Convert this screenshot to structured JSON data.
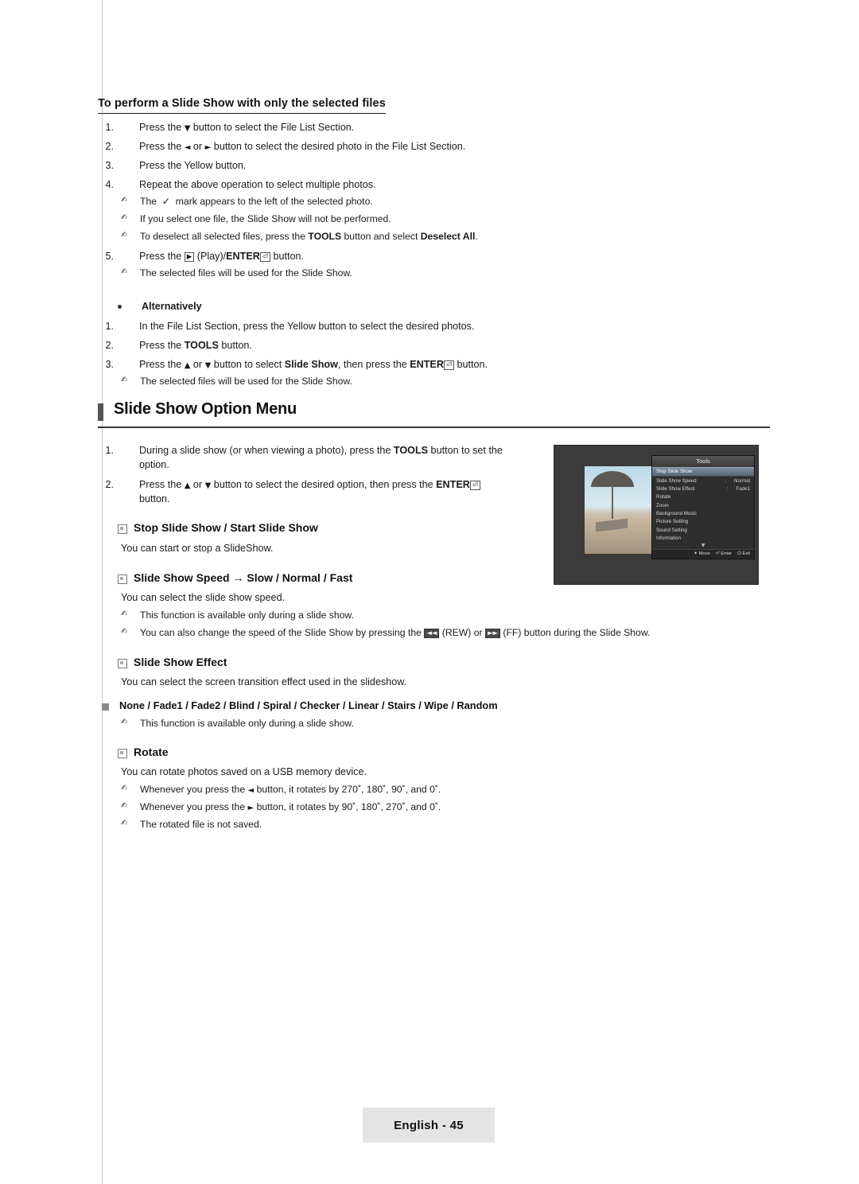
{
  "doc": {
    "section_title": "To perform a Slide Show with only the selected files",
    "steps": [
      {
        "idx": "1.",
        "text_pre": "Press the ",
        "glyph": "▼",
        "text_post": " button to select the File List Section."
      },
      {
        "idx": "2.",
        "text_pre": "Press the ",
        "glyph": "◄ or ►",
        "text_post": " button to select the desired photo in the File List Section."
      },
      {
        "idx": "3.",
        "text_pre": "Press the Yellow button.",
        "glyph": "",
        "text_post": ""
      },
      {
        "idx": "4.",
        "text_pre": "Repeat the above operation to select multiple photos.",
        "glyph": "",
        "text_post": ""
      }
    ],
    "notes_after_4": [
      "The  ✓  mark appears to the left of the selected photo.",
      "If you select one file, the Slide Show will not be performed.",
      "To deselect all selected files, press the TOOLS button and select Deselect All."
    ],
    "step5": {
      "idx": "5.",
      "text": "Press the ▶ (Play)/ENTER⏎ button."
    },
    "note_after_5": "The selected files will be used for the Slide Show.",
    "alternatively_label": "Alternatively",
    "alt_steps": [
      {
        "idx": "1.",
        "text": "In the File List Section, press the Yellow button to select the desired photos."
      },
      {
        "idx": "2.",
        "text": "Press the TOOLS button."
      },
      {
        "idx": "3.",
        "text": "Press the ▲ or ▼ button to select Slide Show, then press the ENTER⏎ button."
      }
    ],
    "alt_note": "The selected files will be used for the Slide Show.",
    "big_heading": "Slide Show Option Menu",
    "menu_steps": [
      {
        "idx": "1.",
        "line1": "During a slide show (or when viewing a photo), press the TOOLS button to set the",
        "line2": "option."
      },
      {
        "idx": "2.",
        "line1": "Press the ▲ or ▼ button to select the desired option, then press the ENTER⏎",
        "line2": "button."
      }
    ],
    "options": [
      {
        "title": "Stop Slide Show / Start Slide Show",
        "body": "You can start or stop a SlideShow.",
        "notes": []
      },
      {
        "title": "Slide Show Speed → Slow / Normal / Fast",
        "body": "You can select the slide show speed.",
        "notes": [
          "This function is available only during a slide show.",
          "You can also change the speed of the Slide Show by pressing the ◄◄ (REW) or ►► (FF) button during the Slide Show."
        ]
      },
      {
        "title": "Slide Show Effect",
        "body": "You can select the screen transition effect used in the slideshow.",
        "notes": []
      }
    ],
    "effect_list": "None / Fade1 / Fade2 / Blind / Spiral / Checker / Linear / Stairs / Wipe / Random",
    "effect_note": "This function is available only during a slide show.",
    "rotate": {
      "title": "Rotate",
      "body": "You can rotate photos saved on a USB memory device.",
      "notes": [
        "Whenever you press the ◄ button, it rotates by 270˚, 180˚, 90˚, and 0˚.",
        "Whenever you press the ► button, it rotates by 90˚, 180˚, 270˚, and 0˚.",
        "The rotated file is not saved."
      ]
    },
    "footer": "English - 45"
  },
  "tv": {
    "menu_title": "Tools",
    "items": [
      {
        "label": "Stop Slide Show",
        "value": "",
        "selected": true
      },
      {
        "label": "Slide Show Speed",
        "value": "Normal",
        "selected": false
      },
      {
        "label": "Slide Show Effect",
        "value": "Fade1",
        "selected": false
      },
      {
        "label": "Rotate",
        "value": "",
        "selected": false
      },
      {
        "label": "Zoom",
        "value": "",
        "selected": false
      },
      {
        "label": "Background Music",
        "value": "",
        "selected": false
      },
      {
        "label": "Picture Setting",
        "value": "",
        "selected": false
      },
      {
        "label": "Sound Setting",
        "value": "",
        "selected": false
      },
      {
        "label": "Information",
        "value": "",
        "selected": false
      }
    ],
    "scroll_glyph": "▼",
    "footer": [
      {
        "icon": "✦",
        "label": "Move"
      },
      {
        "icon": "⏎",
        "label": "Enter"
      },
      {
        "icon": "⏻",
        "label": "Exit"
      }
    ]
  }
}
